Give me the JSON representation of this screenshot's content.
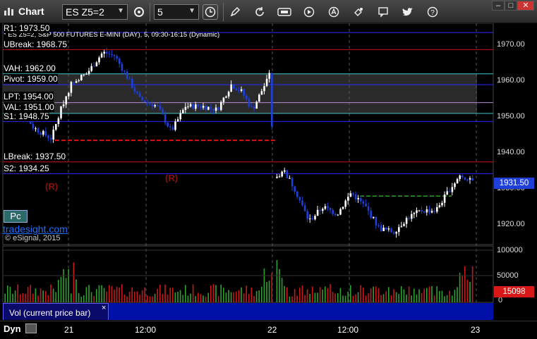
{
  "app": {
    "title": "Chart"
  },
  "toolbar": {
    "symbol": "ES Z5=2",
    "interval": "5"
  },
  "chart_header": "* ES Z5=2, S&P 500 FUTURES E-MINI (DAY), 5, 09:30-16:15 (Dynamic)",
  "levels": [
    {
      "label": "R1: 1973.50",
      "price": 1973.5,
      "color": "#2a2aff",
      "style": "solid"
    },
    {
      "label": "UBreak: 1968.75",
      "price": 1968.75,
      "color": "#d01010",
      "style": "solid"
    },
    {
      "label": "VAH: 1962.00",
      "price": 1962.0,
      "color": "#40c8c8",
      "style": "solid"
    },
    {
      "label": "Pivot: 1959.00",
      "price": 1959.0,
      "color": "#2a2aff",
      "style": "solid"
    },
    {
      "label": "LPT: 1954.00",
      "price": 1954.0,
      "color": "#b888d8",
      "style": "solid"
    },
    {
      "label": "VAL: 1951.00",
      "price": 1951.0,
      "color": "#40c8c8",
      "style": "solid"
    },
    {
      "label": "S1: 1948.75",
      "price": 1948.75,
      "color": "#2a2aff",
      "style": "solid"
    },
    {
      "label": "LBreak: 1937.50",
      "price": 1937.5,
      "color": "#d01010",
      "style": "solid"
    },
    {
      "label": "S2: 1934.25",
      "price": 1934.25,
      "color": "#2a2aff",
      "style": "solid"
    }
  ],
  "annotations": {
    "r_label": "(R)",
    "pc_button": "Pc",
    "tradesight": "tradesight.com",
    "copyright": "© eSignal, 2015"
  },
  "price_axis": {
    "labels": [
      "1970.00",
      "1960.00",
      "1950.00",
      "1940.00",
      "1930.00",
      "1920.00"
    ],
    "current_price": "1931.50",
    "current_price_color": "#1e3fd9"
  },
  "volume_axis": {
    "labels": [
      "100000",
      "50000",
      "0"
    ],
    "current_volume": "15098",
    "current_volume_color": "#d81818"
  },
  "volume_panel": {
    "tab_label": "Vol (current price bar)",
    "close_icon": "×"
  },
  "time_axis": {
    "mode": "Dyn",
    "labels": [
      "21",
      "12:00",
      "22",
      "12:00",
      "23"
    ]
  },
  "chart_data": {
    "type": "candlestick",
    "title": "",
    "ylim": [
      1914,
      1979
    ],
    "colors": {
      "up": "#ffffff",
      "down": "#1e3fd9",
      "volume_up": "#2fa02f",
      "volume_down": "#c81818"
    },
    "grid": true,
    "sessions": [
      "21",
      "22"
    ]
  }
}
